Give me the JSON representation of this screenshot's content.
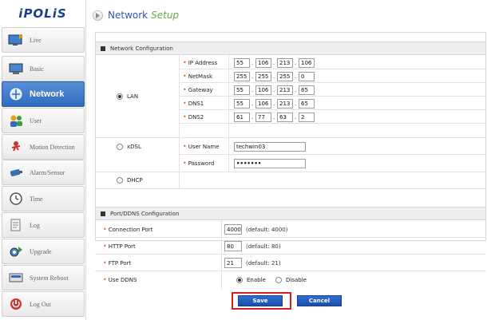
{
  "logo": "iPOLiS",
  "sidebar": {
    "items": [
      {
        "label": "Live",
        "icon": "monitor-play-icon"
      },
      {
        "label": "Basic",
        "icon": "monitor-icon"
      },
      {
        "label": "Network",
        "icon": "network-icon",
        "active": true
      },
      {
        "label": "User",
        "icon": "users-icon"
      },
      {
        "label": "Motion Detection",
        "icon": "motion-detection-icon"
      },
      {
        "label": "Alarm/Sensor",
        "icon": "alarm-camera-icon"
      },
      {
        "label": "Time",
        "icon": "clock-icon"
      },
      {
        "label": "Log",
        "icon": "document-icon"
      },
      {
        "label": "Upgrade",
        "icon": "gear-upgrade-icon"
      },
      {
        "label": "System Reboot",
        "icon": "reboot-icon"
      },
      {
        "label": "Log Out",
        "icon": "logout-icon"
      }
    ]
  },
  "header": {
    "title": "Network",
    "subtitle": "Setup"
  },
  "network_config": {
    "title": "Network Configuration",
    "lan_label": "LAN",
    "ip_label": "IP Address",
    "ip": [
      "55",
      "106",
      "213",
      "106"
    ],
    "netmask_label": "NetMask",
    "netmask": [
      "255",
      "255",
      "255",
      "0"
    ],
    "gateway_label": "Gateway",
    "gateway": [
      "55",
      "106",
      "213",
      "65"
    ],
    "dns1_label": "DNS1",
    "dns1": [
      "55",
      "106",
      "213",
      "65"
    ],
    "dns2_label": "DNS2",
    "dns2": [
      "61",
      "77",
      "63",
      "2"
    ],
    "xdsl_label": "xDSL",
    "username_label": "User Name",
    "username": "techwin03",
    "password_label": "Password",
    "password": "•••••••",
    "dhcp_label": "DHCP"
  },
  "port_config": {
    "title": "Port/DDNS Configuration",
    "connection_port_label": "Connection Port",
    "connection_port": "4000",
    "connection_port_hint": "(default: 4000)",
    "http_port_label": "HTTP Port",
    "http_port": "80",
    "http_port_hint": "(default: 80)",
    "ftp_port_label": "FTP Port",
    "ftp_port": "21",
    "ftp_port_hint": "(default: 21)",
    "ddns_label": "Use DDNS",
    "ddns_enable": "Enable",
    "ddns_disable": "Disable"
  },
  "buttons": {
    "save": "Save",
    "cancel": "Cancel"
  },
  "colors": {
    "accent": "#2f6bc0",
    "highlight": "#d81e1e",
    "bullet": "#e06a1b"
  }
}
